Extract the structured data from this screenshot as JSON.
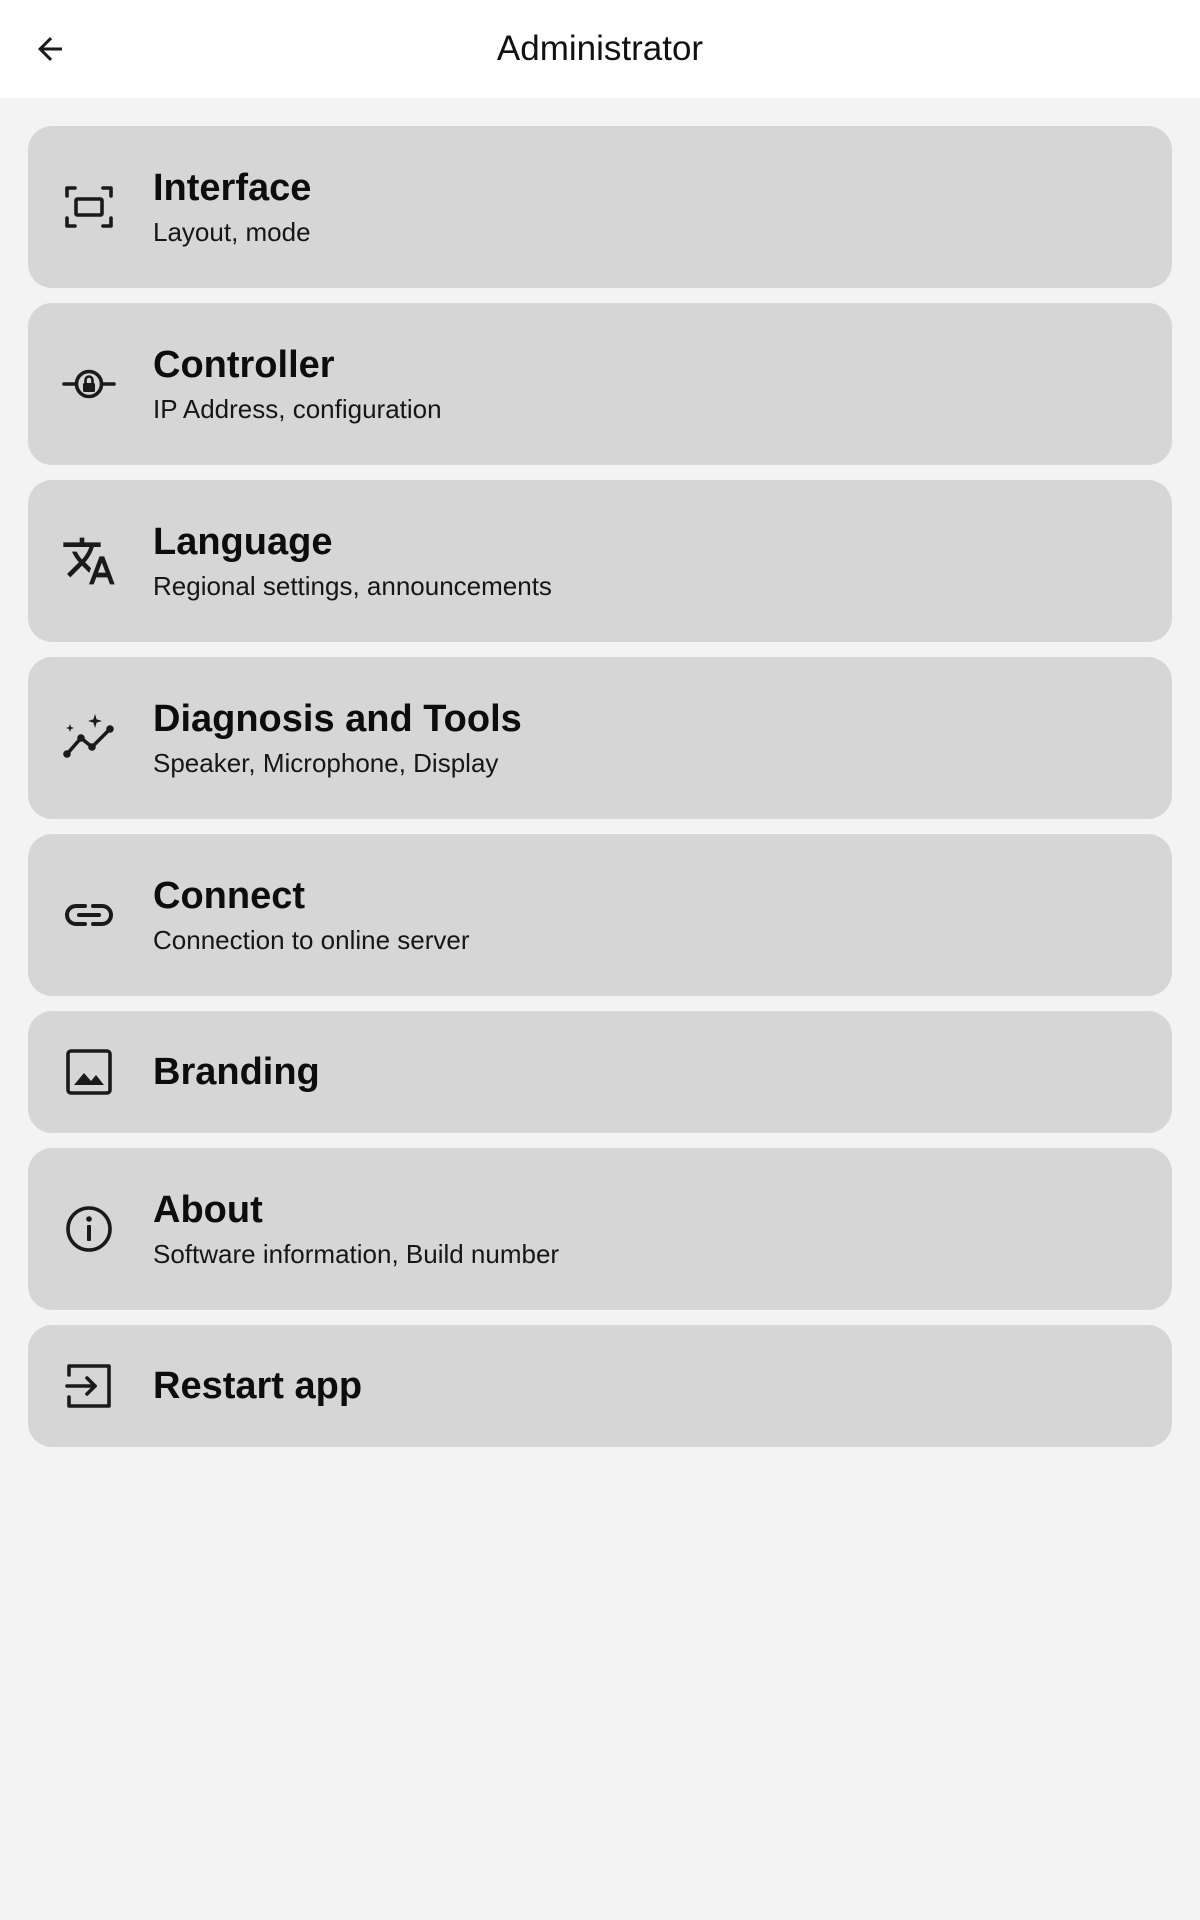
{
  "header": {
    "title": "Administrator",
    "back_icon": "arrow-back-icon"
  },
  "menu": {
    "items": [
      {
        "icon": "fit-screen-icon",
        "title": "Interface",
        "subtitle": "Layout, mode"
      },
      {
        "icon": "controller-lock-icon",
        "title": "Controller",
        "subtitle": "IP Address, configuration"
      },
      {
        "icon": "translate-icon",
        "title": "Language",
        "subtitle": "Regional settings, announcements"
      },
      {
        "icon": "diagnosis-chart-icon",
        "title": "Diagnosis and Tools",
        "subtitle": "Speaker, Microphone, Display"
      },
      {
        "icon": "link-icon",
        "title": "Connect",
        "subtitle": "Connection to online server"
      },
      {
        "icon": "image-icon",
        "title": "Branding"
      },
      {
        "icon": "info-icon",
        "title": "About",
        "subtitle": "Software information, Build number"
      },
      {
        "icon": "login-icon",
        "title": "Restart app"
      }
    ]
  },
  "colors": {
    "background": "#f3f3f3",
    "app_bar": "#ffffff",
    "card": "#d6d6d6",
    "icon": "#1a1a1a"
  }
}
